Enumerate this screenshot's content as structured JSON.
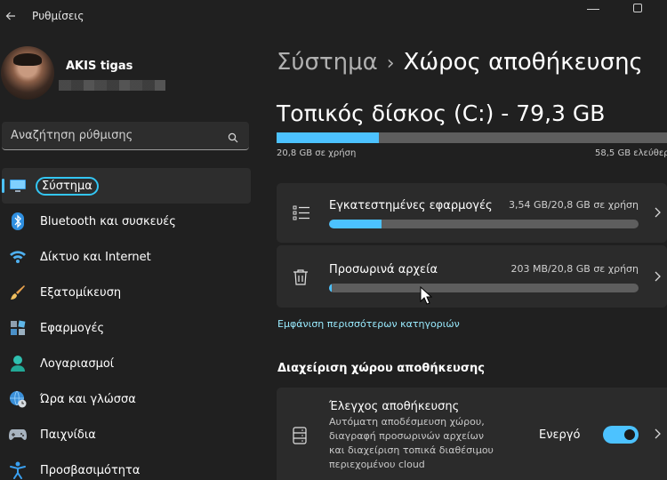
{
  "window": {
    "title": "Ρυθμίσεις"
  },
  "profile": {
    "name": "AKIS tigas"
  },
  "search": {
    "placeholder": "Αναζήτηση ρύθμισης"
  },
  "nav": {
    "items": [
      {
        "label": "Σύστημα",
        "icon": "monitor-icon",
        "active": true
      },
      {
        "label": "Bluetooth και συσκευές",
        "icon": "bluetooth-icon"
      },
      {
        "label": "Δίκτυο και Internet",
        "icon": "wifi-icon"
      },
      {
        "label": "Εξατομίκευση",
        "icon": "brush-icon"
      },
      {
        "label": "Εφαρμογές",
        "icon": "apps-icon"
      },
      {
        "label": "Λογαριασμοί",
        "icon": "person-icon"
      },
      {
        "label": "Ώρα και γλώσσα",
        "icon": "clock-globe-icon"
      },
      {
        "label": "Παιχνίδια",
        "icon": "gamepad-icon"
      },
      {
        "label": "Προσβασιμότητα",
        "icon": "accessibility-icon"
      }
    ]
  },
  "breadcrumb": {
    "parent": "Σύστημα",
    "separator": "›",
    "current": "Χώρος αποθήκευσης"
  },
  "disk": {
    "title": "Τοπικός δίσκος (C:) - 79,3 GB",
    "used_label": "20,8 GB σε χρήση",
    "free_label": "58,5 GB ελεύθερα",
    "used_fraction": 0.262
  },
  "categories": [
    {
      "title": "Εγκατεστημένες εφαρμογές",
      "usage": "3,54 GB/20,8 GB σε χρήση",
      "fraction": 0.17,
      "icon": "list-icon"
    },
    {
      "title": "Προσωρινά αρχεία",
      "usage": "203 MB/20,8 GB σε χρήση",
      "fraction": 0.0098,
      "icon": "trash-icon"
    }
  ],
  "more_link": "Εμφάνιση περισσότερων κατηγοριών",
  "management": {
    "heading": "Διαχείριση χώρου αποθήκευσης",
    "storage_sense": {
      "title": "Έλεγχος αποθήκευσης",
      "description": "Αυτόματη αποδέσμευση χώρου, διαγραφή προσωρινών αρχείων και διαχείριση τοπικά διαθέσιμου περιεχομένου cloud",
      "toggle_label": "Ενεργό",
      "enabled": true
    }
  },
  "colors": {
    "accent": "#4cc2ff",
    "background": "#202020",
    "card": "#2b2b2b"
  }
}
